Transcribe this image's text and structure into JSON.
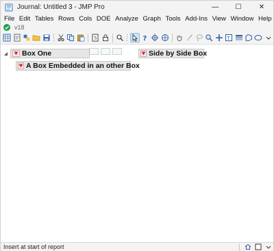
{
  "window": {
    "title": "Journal: Untitled 3 - JMP Pro",
    "minimize_glyph": "—",
    "maximize_glyph": "☐",
    "close_glyph": "✕"
  },
  "menu": [
    "File",
    "Edit",
    "Tables",
    "Rows",
    "Cols",
    "DOE",
    "Analyze",
    "Graph",
    "Tools",
    "Add-Ins",
    "View",
    "Window",
    "Help"
  ],
  "version_label": "v18",
  "toolbar": {
    "icons": [
      "new-data-table-icon",
      "new-script-icon",
      "python-icon",
      "open-icon",
      "save-icon",
      "cut-icon",
      "copy-icon",
      "paste-icon",
      "journal-icon",
      "lock-icon",
      "search-icon",
      "arrow-tool-icon",
      "help-tool-icon",
      "crosshair-icon",
      "scroller-icon",
      "grabber-icon",
      "brush-icon",
      "lasso-icon",
      "magnifier-icon",
      "annotate-icon",
      "simple-shape-icon",
      "line-icon",
      "polygon-icon",
      "ellipse-icon"
    ],
    "active_tool": "arrow-tool-icon"
  },
  "report": {
    "outline_1": "Box One",
    "outline_2": "Side by Side Box",
    "outline_3": "A Box Embedded in an other Box"
  },
  "status": {
    "text": "Insert at start of report"
  },
  "colors": {
    "accent": "#1f9e4a",
    "outline_header": "#e6e6e6",
    "red_triangle": "#d6202a"
  }
}
